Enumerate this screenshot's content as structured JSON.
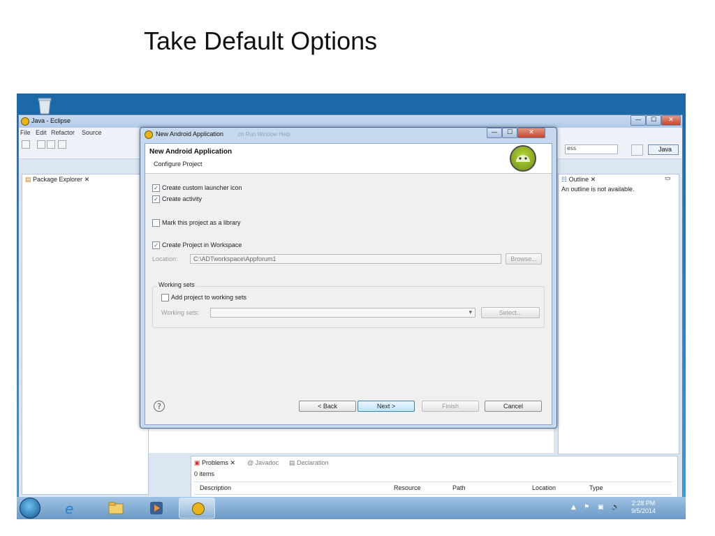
{
  "slide": {
    "title": "Take Default Options"
  },
  "eclipse": {
    "window_title": "Java - Eclipse",
    "menu": [
      "File",
      "Edit",
      "Refactor",
      "Source"
    ],
    "quick_access": "ess",
    "perspective": "Java",
    "package_explorer_tab": "Package Explorer",
    "outline_tab": "Outline",
    "outline_message": "An outline is not available.",
    "bottom_tabs": [
      "Problems",
      "Javadoc",
      "Declaration"
    ],
    "problems_count": "0 items",
    "columns": [
      "Description",
      "Resource",
      "Path",
      "Location",
      "Type"
    ],
    "window_controls": {
      "minimize": "—",
      "maximize": "☐",
      "close": "✕"
    }
  },
  "dialog": {
    "window_title": "New Android Application",
    "faded_menu": "ch  Run  Window  Help",
    "header_title": "New Android Application",
    "header_subtitle": "Configure Project",
    "options": [
      {
        "label": "Create custom launcher icon",
        "checked": true
      },
      {
        "label": "Create activity",
        "checked": true
      },
      {
        "label": "Mark this project as a library",
        "checked": false
      },
      {
        "label": "Create Project in Workspace",
        "checked": true
      }
    ],
    "location_label": "Location:",
    "location_value": "C:\\ADTworkspace\\Appforum1",
    "browse_label": "Browse...",
    "working_sets_group": "Working sets",
    "add_to_working_sets": {
      "label": "Add project to working sets",
      "checked": false
    },
    "working_sets_label": "Working sets:",
    "select_label": "Select...",
    "help_symbol": "?",
    "buttons": {
      "back": "< Back",
      "next": "Next >",
      "finish": "Finish",
      "cancel": "Cancel"
    }
  },
  "taskbar": {
    "time": "2:28 PM",
    "date": "9/5/2014",
    "icons": [
      "start-orb",
      "ie-icon",
      "file-explorer-icon",
      "media-player-icon",
      "eclipse-icon"
    ]
  },
  "colors": {
    "android_green": "#a4c639",
    "taskbar": "#6b99c6",
    "dialog_frame": "#c7d9ee"
  }
}
